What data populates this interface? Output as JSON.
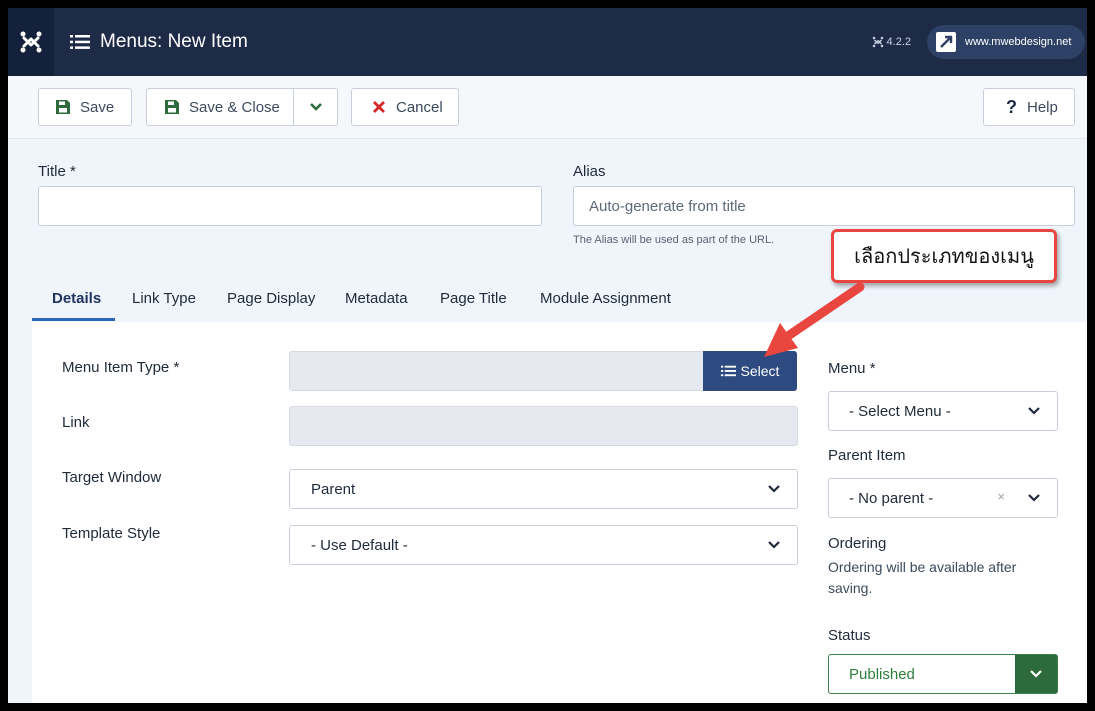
{
  "header": {
    "title": "Menus: New Item",
    "version": "4.2.2",
    "site_link": "www.mwebdesign.net"
  },
  "toolbar": {
    "save_label": "Save",
    "save_close_label": "Save & Close",
    "cancel_label": "Cancel",
    "help_label": "Help"
  },
  "form": {
    "title_label": "Title *",
    "title_value": "",
    "alias_label": "Alias",
    "alias_placeholder": "Auto-generate from title",
    "alias_hint": "The Alias will be used as part of the URL."
  },
  "callout": {
    "text": "เลือกประเภทของเมนู"
  },
  "tabs": [
    {
      "label": "Details"
    },
    {
      "label": "Link Type"
    },
    {
      "label": "Page Display"
    },
    {
      "label": "Metadata"
    },
    {
      "label": "Page Title"
    },
    {
      "label": "Module Assignment"
    }
  ],
  "details": {
    "menu_item_type_label": "Menu Item Type *",
    "select_button_label": "Select",
    "link_label": "Link",
    "target_window_label": "Target Window",
    "target_window_value": "Parent",
    "template_style_label": "Template Style",
    "template_style_value": "- Use Default -"
  },
  "sidebar": {
    "menu_label": "Menu *",
    "menu_value": "- Select Menu -",
    "parent_item_label": "Parent Item",
    "parent_item_value": "- No parent -",
    "parent_item_clear": "×",
    "ordering_label": "Ordering",
    "ordering_note": "Ordering will be available after saving.",
    "status_label": "Status",
    "status_value": "Published"
  },
  "colors": {
    "header_bg": "#1d2b46",
    "select_button_bg": "#2d4b80",
    "status_green": "#2e6b3c",
    "cancel_red": "#d62828",
    "callout_border": "#e8463f"
  }
}
